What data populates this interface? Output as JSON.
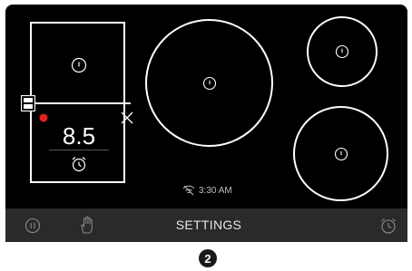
{
  "cooktop": {
    "zones": [
      {
        "id": "left-bridge",
        "power_icon": "power-icon"
      },
      {
        "id": "center-large",
        "power_icon": "power-icon"
      },
      {
        "id": "right-top-small",
        "power_icon": "power-icon"
      },
      {
        "id": "right-bottom-medium",
        "power_icon": "power-icon"
      }
    ],
    "active_zone": {
      "value": "8.5",
      "indicator_color": "#e02020",
      "icons": [
        "bridge-icon",
        "close-icon",
        "alarm-clock-icon"
      ]
    },
    "status": {
      "wifi_icon": "wifi-icon",
      "time": "3:30 AM"
    }
  },
  "bottom_bar": {
    "settings_label": "SETTINGS",
    "icons": [
      "pause-icon",
      "hand-lock-icon",
      "timer-icon"
    ]
  },
  "page_badge": "2",
  "colors": {
    "panel": "#000000",
    "bar": "#2a2a2a",
    "accent_red": "#e02020",
    "stroke": "#ffffff"
  }
}
